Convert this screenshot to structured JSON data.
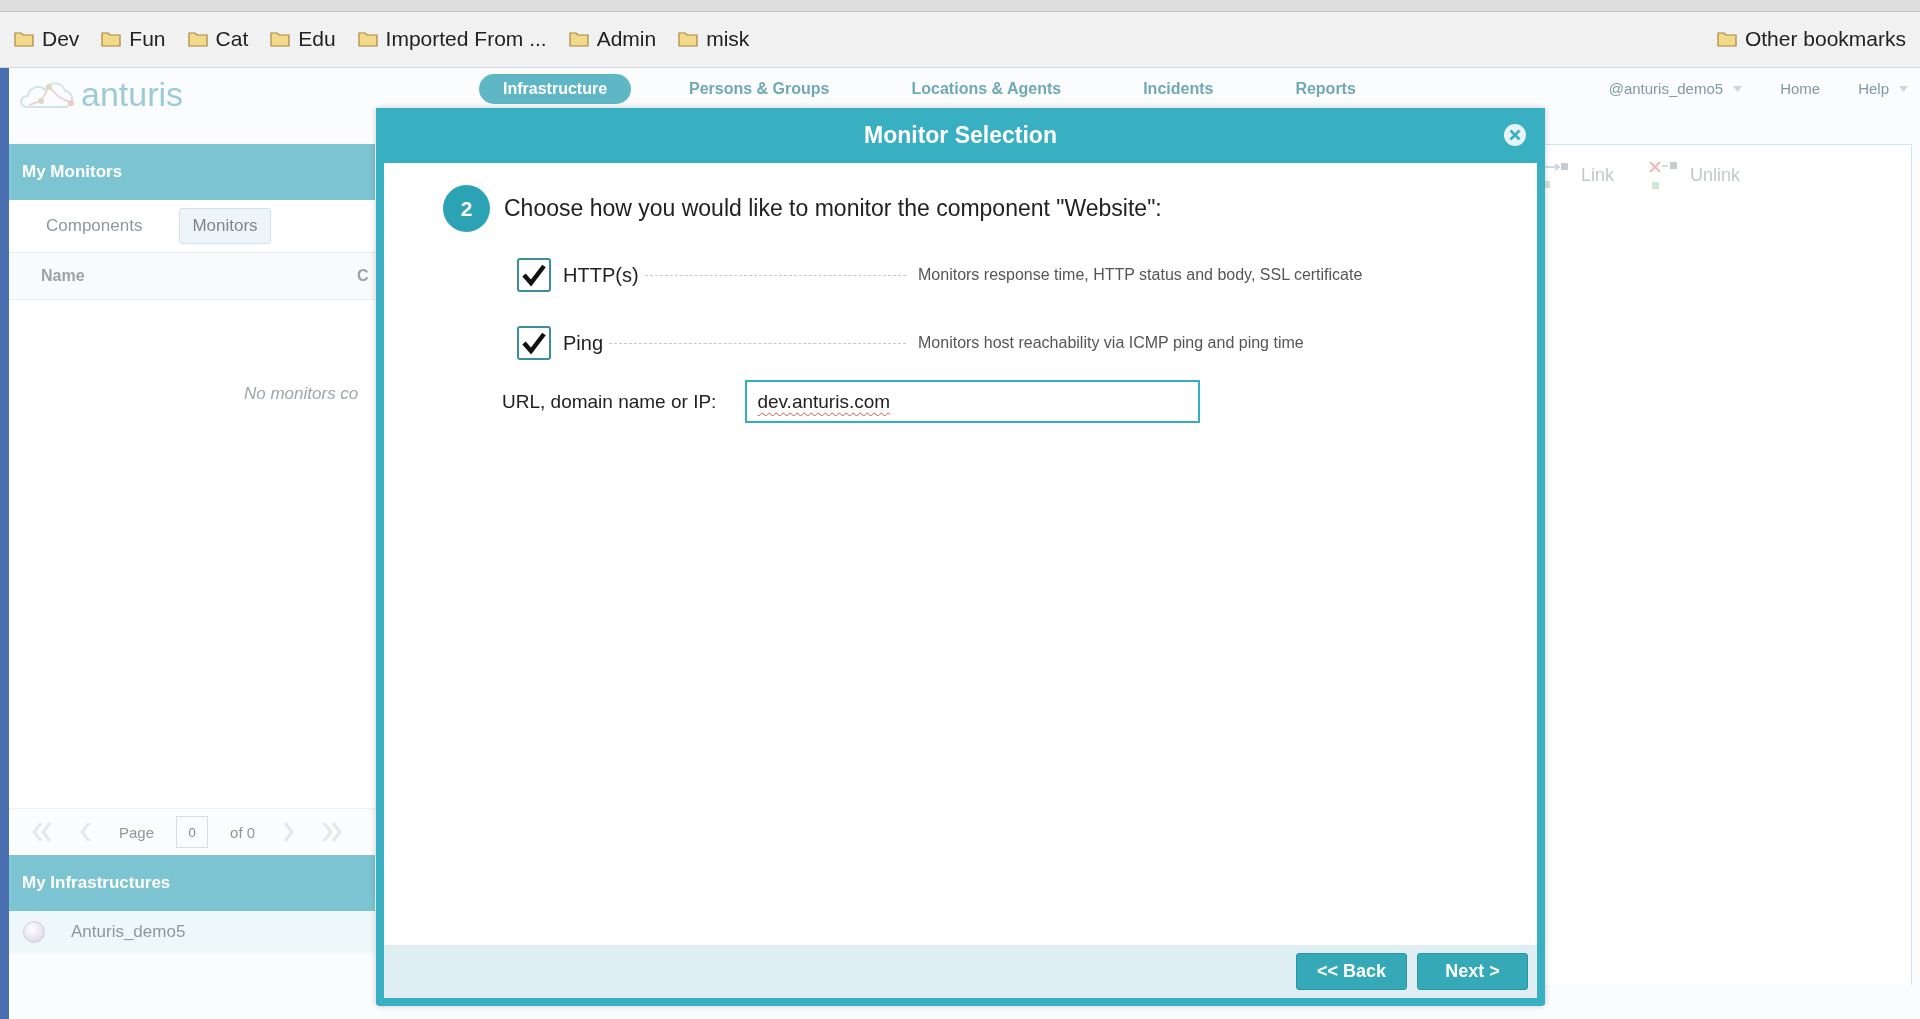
{
  "browser": {
    "bookmarks": [
      "Dev",
      "Fun",
      "Cat",
      "Edu",
      "Imported From ...",
      "Admin",
      "misk"
    ],
    "other_bookmarks": "Other bookmarks"
  },
  "app": {
    "logo": "anturis",
    "nav": [
      {
        "label": "Infrastructure",
        "selected": true
      },
      {
        "label": "Persons & Groups",
        "selected": false
      },
      {
        "label": "Locations & Agents",
        "selected": false
      },
      {
        "label": "Incidents",
        "selected": false
      },
      {
        "label": "Reports",
        "selected": false
      }
    ],
    "user_menu": "@anturis_demo5",
    "home": "Home",
    "help": "Help"
  },
  "monitors_panel": {
    "title": "My Monitors",
    "tabs": [
      {
        "label": "Components",
        "selected": false
      },
      {
        "label": "Monitors",
        "selected": true
      }
    ],
    "columns": [
      "Name",
      "C"
    ],
    "empty_text": "No monitors co",
    "pager": {
      "page_label": "Page",
      "page_value": "0",
      "of_label": "of 0"
    }
  },
  "infrastructures_panel": {
    "title": "My Infrastructures",
    "items": [
      {
        "name": "Anturis_demo5"
      }
    ]
  },
  "toolbar": [
    "Link",
    "Unlink"
  ],
  "dialog": {
    "title": "Monitor Selection",
    "step": "2",
    "prompt": "Choose how you would like to monitor the component \"Website\":",
    "options": [
      {
        "label": "HTTP(s)",
        "checked": true,
        "description": "Monitors response time, HTTP status and body, SSL certificate"
      },
      {
        "label": "Ping",
        "checked": true,
        "description": "Monitors host reachability via ICMP ping and ping time"
      }
    ],
    "url_label": "URL, domain name or IP:",
    "url_value": "dev.anturis.com",
    "buttons": [
      "<< Back",
      "Next >"
    ]
  }
}
